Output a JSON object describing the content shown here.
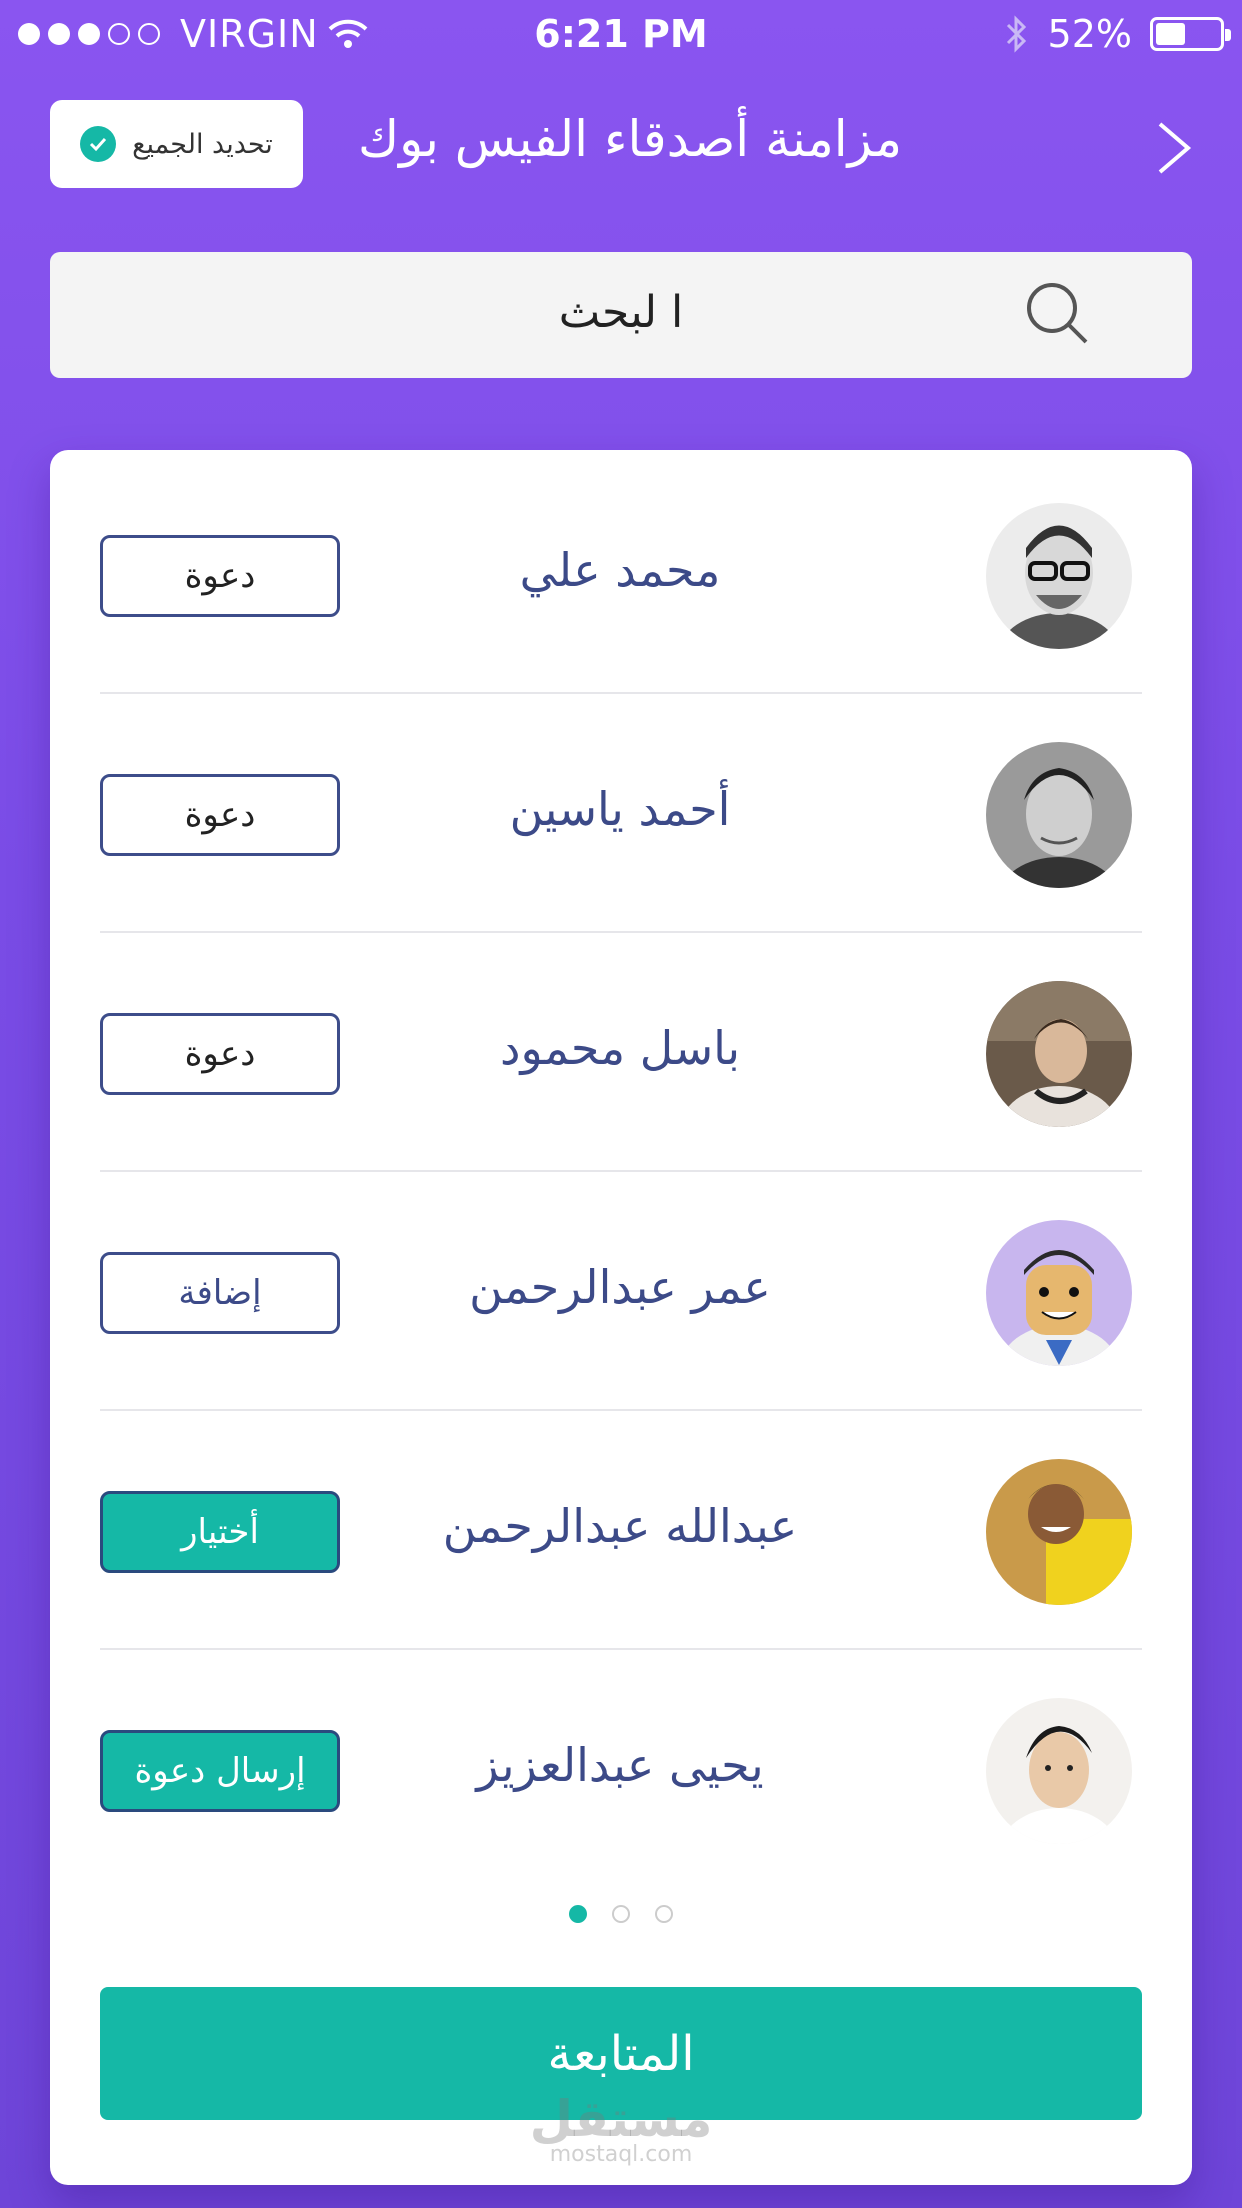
{
  "status_bar": {
    "carrier": "VIRGIN",
    "time": "6:21 PM",
    "battery": "52%",
    "battery_level": 0.52
  },
  "header": {
    "title": "مزامنة أصدقاء الفيس بوك",
    "update_all_label": "تحديد الجميع"
  },
  "search": {
    "placeholder": "ا لبحث"
  },
  "friends": [
    {
      "name": "محمد علي",
      "action": "دعوة",
      "style": "outline"
    },
    {
      "name": "أحمد ياسين",
      "action": "دعوة",
      "style": "outline"
    },
    {
      "name": "باسل محمود",
      "action": "دعوة",
      "style": "outline"
    },
    {
      "name": "عمر عبدالرحمن",
      "action": "إضافة",
      "style": "add"
    },
    {
      "name": "عبدالله عبدالرحمن",
      "action": "أختيار",
      "style": "teal"
    },
    {
      "name": "يحيى عبدالعزيز",
      "action": "إرسال دعوة",
      "style": "teal"
    }
  ],
  "pagination": {
    "pages": 3,
    "active": 1
  },
  "continue_label": "المتابعة",
  "watermark": {
    "logo": "مستقل",
    "url": "mostaql.com"
  },
  "colors": {
    "accent": "#15b8a6",
    "background": "#7e4fea",
    "name_text": "#3c4a88"
  }
}
